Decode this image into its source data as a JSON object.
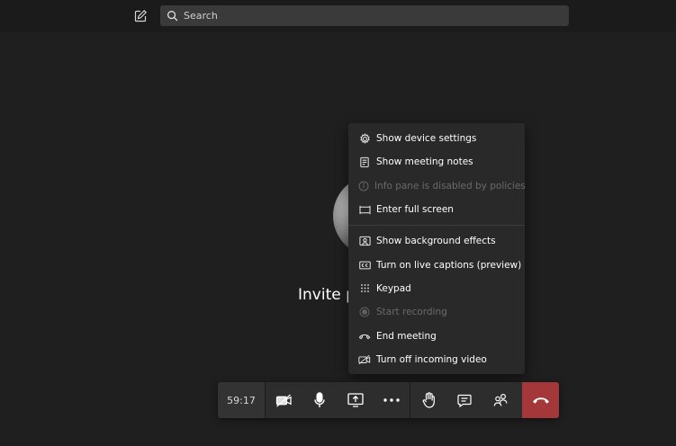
{
  "search": {
    "placeholder": "Search"
  },
  "stage": {
    "invite_text": "Invite p"
  },
  "menu": {
    "items": [
      {
        "label": "Show device settings",
        "icon": "gear-icon",
        "disabled": false
      },
      {
        "label": "Show meeting notes",
        "icon": "notes-icon",
        "disabled": false
      },
      {
        "label": "Info pane is disabled by policies",
        "icon": "info-icon",
        "disabled": true
      },
      {
        "label": "Enter full screen",
        "icon": "fullscreen-icon",
        "disabled": false
      },
      {
        "label": "Show background effects",
        "icon": "background-effects-icon",
        "disabled": false
      },
      {
        "label": "Turn on live captions (preview)",
        "icon": "captions-icon",
        "disabled": false
      },
      {
        "label": "Keypad",
        "icon": "keypad-icon",
        "disabled": false
      },
      {
        "label": "Start recording",
        "icon": "record-icon",
        "disabled": true
      },
      {
        "label": "End meeting",
        "icon": "end-meeting-icon",
        "disabled": false
      },
      {
        "label": "Turn off incoming video",
        "icon": "video-off-icon",
        "disabled": false
      }
    ]
  },
  "toolbar": {
    "timer": "59:17"
  },
  "colors": {
    "hangup": "#a4373a",
    "menu_bg": "#292929",
    "background": "#1f1f1f"
  }
}
